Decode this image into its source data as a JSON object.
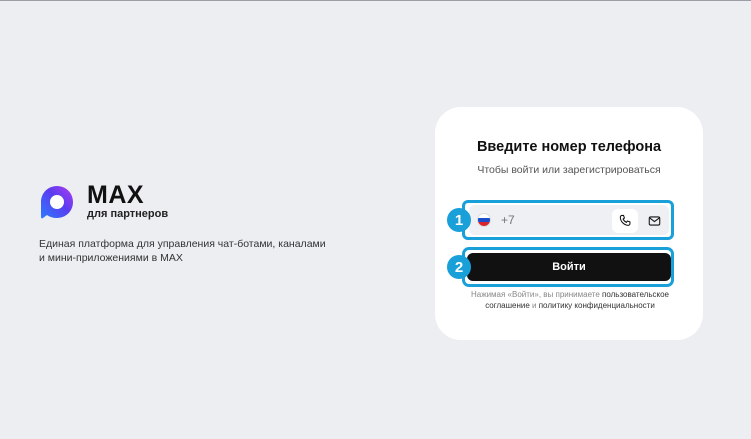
{
  "brand": {
    "name": "MAX",
    "subtitle": "для партнеров",
    "tagline_line1": "Единая платформа для управления чат-ботами, каналами",
    "tagline_line2": "и мини-приложениями в MAX"
  },
  "login": {
    "title": "Введите номер телефона",
    "subtitle": "Чтобы войти или зарегистрироваться",
    "phone_prefix": "+7",
    "phone_value": "",
    "submit_label": "Войти",
    "legal_prefix": "Нажимая «Войти», вы принимаете ",
    "legal_link1": "пользовательское соглашение",
    "legal_and": " и ",
    "legal_link2": "политику конфиденциальности"
  },
  "annotations": {
    "badge1": "1",
    "badge2": "2"
  },
  "colors": {
    "accent": "#1aa0d8",
    "button": "#111111",
    "background": "#eceef1"
  },
  "icons": {
    "logo": "max-logo-icon",
    "flag": "russia-flag-icon",
    "phone": "phone-icon",
    "mail": "mail-icon"
  }
}
